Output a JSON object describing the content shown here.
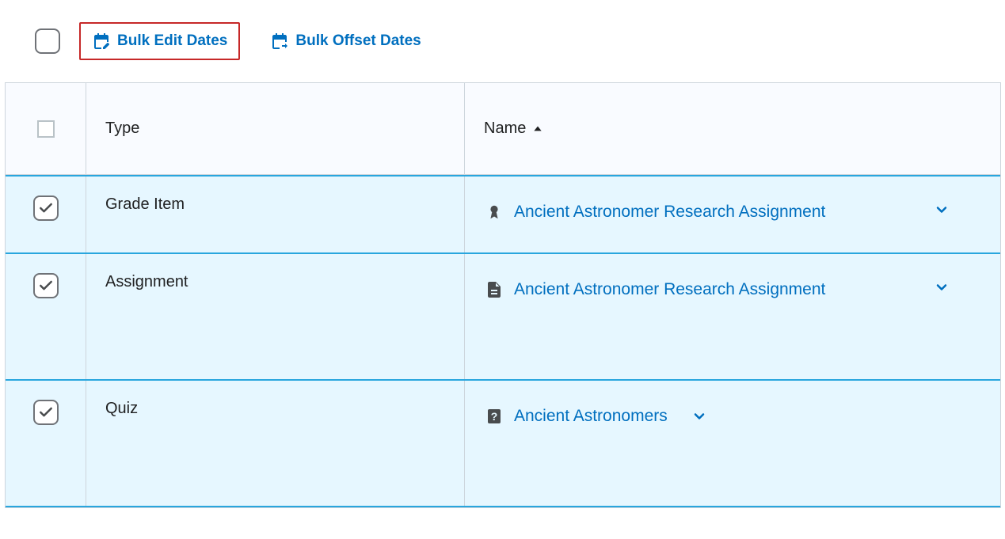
{
  "toolbar": {
    "bulk_edit_label": "Bulk Edit Dates",
    "bulk_offset_label": "Bulk Offset Dates"
  },
  "table": {
    "headers": {
      "type": "Type",
      "name": "Name"
    },
    "rows": [
      {
        "checked": true,
        "type": "Grade Item",
        "icon": "ribbon",
        "name": "Ancient Astronomer Research Assignment"
      },
      {
        "checked": true,
        "type": "Assignment",
        "icon": "document",
        "name": "Ancient Astronomer Research Assignment"
      },
      {
        "checked": true,
        "type": "Quiz",
        "icon": "question",
        "name": "Ancient Astronomers"
      }
    ]
  }
}
